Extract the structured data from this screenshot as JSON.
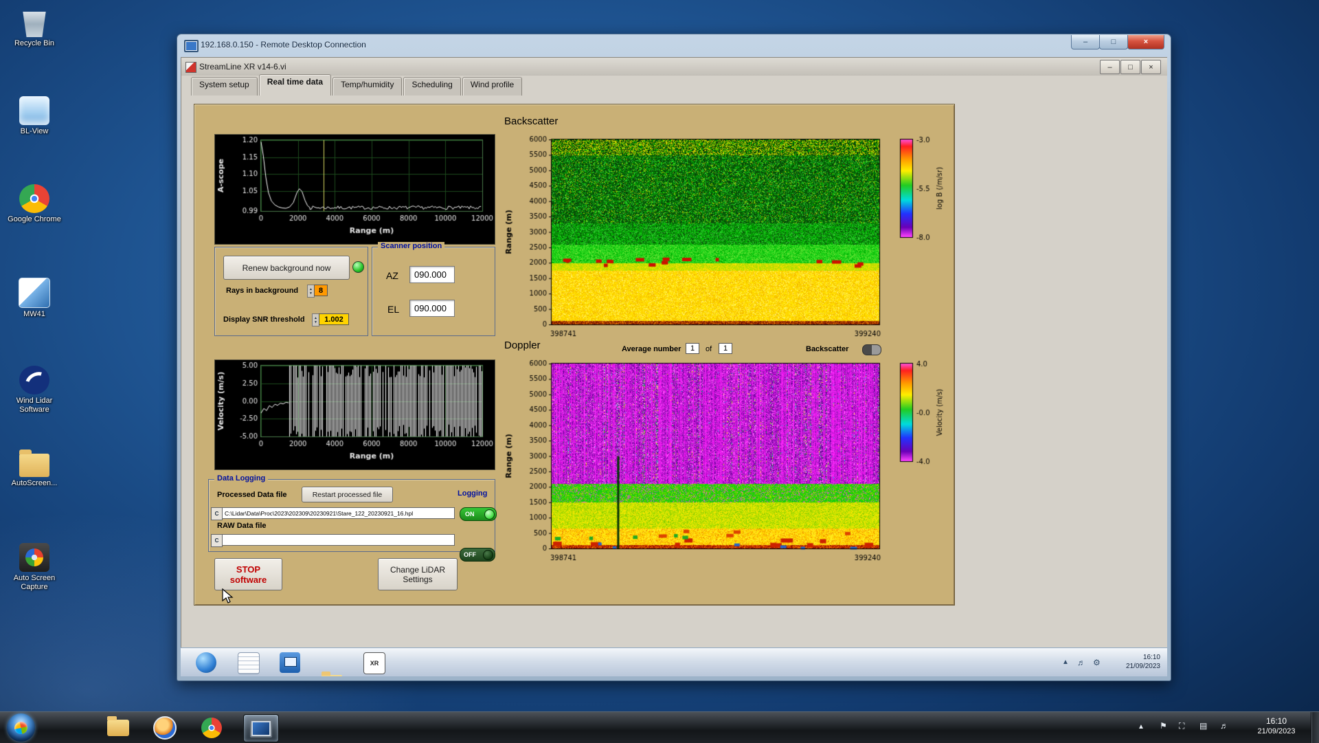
{
  "desktop": {
    "icons": [
      {
        "label": "Recycle Bin"
      },
      {
        "label": "BL-View"
      },
      {
        "label": "Google Chrome"
      },
      {
        "label": "MW41"
      },
      {
        "label": "Wind Lidar Software"
      },
      {
        "label": "AutoScreen..."
      },
      {
        "label": "Auto Screen Capture"
      }
    ]
  },
  "taskbar": {
    "clock_time": "16:10",
    "clock_date": "21/09/2023"
  },
  "rdp": {
    "title": "192.168.0.150 - Remote Desktop Connection"
  },
  "remote_taskbar": {
    "clock_time": "16:10",
    "clock_date": "21/09/2023"
  },
  "app": {
    "title": "StreamLine XR v14-6.vi",
    "tabs": [
      {
        "label": "System setup"
      },
      {
        "label": "Real time data"
      },
      {
        "label": "Temp/humidity"
      },
      {
        "label": "Scheduling"
      },
      {
        "label": "Wind profile"
      }
    ],
    "backscatter_section_label": "Backscatter",
    "doppler_section_label": "Doppler",
    "renew_button_label": "Renew background now",
    "rays_label": "Rays in background",
    "rays_value": "8",
    "snr_label": "Display SNR threshold",
    "snr_value": "1.002",
    "scanner": {
      "title": "Scanner position",
      "az_label": "AZ",
      "az_value": "090.000",
      "el_label": "EL",
      "el_value": "090.000"
    },
    "average": {
      "label": "Average number",
      "value": "1",
      "of_label": "of",
      "total": "1"
    },
    "backscatter_toggle_label": "Backscatter",
    "logging": {
      "title": "Data Logging",
      "processed_label": "Processed Data file",
      "restart_button_label": "Restart processed file",
      "processed_path": "C:\\Lidar\\Data\\Proc\\2023\\202309\\20230921\\Stare_122_20230921_16.hpl",
      "processed_state": "ON",
      "raw_label": "RAW Data file",
      "raw_path": "",
      "raw_state": "OFF",
      "logging_label": "Logging"
    },
    "stop_button_line1": "STOP",
    "stop_button_line2": "software",
    "settings_button_line1": "Change LiDAR",
    "settings_button_line2": "Settings"
  },
  "chart_data": [
    {
      "id": "ascope",
      "type": "line",
      "ylabel": "A-scope",
      "xlabel": "Range (m)",
      "xlim": [
        0,
        12000
      ],
      "ylim": [
        0.99,
        1.2
      ],
      "xticks": [
        0,
        2000,
        4000,
        6000,
        8000,
        10000,
        12000
      ],
      "yticks": [
        "1.20",
        "1.15",
        "1.10",
        "1.05",
        "0.99"
      ],
      "ytick_vals": [
        1.2,
        1.15,
        1.1,
        1.05,
        0.99
      ],
      "points": [
        [
          0,
          1.195
        ],
        [
          120,
          1.155
        ],
        [
          260,
          1.09
        ],
        [
          400,
          1.045
        ],
        [
          560,
          1.02
        ],
        [
          750,
          1.008
        ],
        [
          950,
          1.002
        ],
        [
          1150,
          0.999
        ],
        [
          1350,
          0.998
        ],
        [
          1550,
          1.002
        ],
        [
          1750,
          1.015
        ],
        [
          1950,
          1.045
        ],
        [
          2080,
          1.056
        ],
        [
          2220,
          1.048
        ],
        [
          2380,
          1.022
        ],
        [
          2520,
          1.006
        ],
        [
          2650,
          1.0
        ]
      ],
      "tail": {
        "from": 2650,
        "base": 1.0,
        "amp": 0.005
      },
      "cursor_x": 3400
    },
    {
      "id": "velocity",
      "type": "line",
      "ylabel": "Velocity (m/s)",
      "xlabel": "Range (m)",
      "xlim": [
        0,
        12000
      ],
      "ylim": [
        -5,
        5
      ],
      "xticks": [
        0,
        2000,
        4000,
        6000,
        8000,
        10000,
        12000
      ],
      "yticks": [
        "5.00",
        "2.50",
        "0.00",
        "-2.50",
        "-5.00"
      ],
      "ytick_vals": [
        5,
        2.5,
        0,
        -2.5,
        -5
      ],
      "points": [
        [
          0,
          -1.7
        ],
        [
          150,
          -1.05
        ],
        [
          300,
          -1.35
        ],
        [
          450,
          -0.65
        ],
        [
          600,
          -0.9
        ],
        [
          750,
          -0.45
        ],
        [
          900,
          -0.6
        ],
        [
          1050,
          -0.3
        ],
        [
          1200,
          -0.4
        ],
        [
          1350,
          -0.18
        ],
        [
          1500,
          -0.25
        ]
      ],
      "spikes": {
        "from": 1500,
        "prob": 0.82
      }
    },
    {
      "id": "backscatter",
      "type": "heatmap",
      "title": "Backscatter",
      "ylabel": "Range (m)",
      "ylim": [
        0,
        6000
      ],
      "yticks": [
        6000,
        5500,
        5000,
        4500,
        4000,
        3500,
        3000,
        2500,
        2000,
        1500,
        1000,
        500,
        0
      ],
      "x_start": "398741",
      "x_end": "399240",
      "colorbar": {
        "label": "log B (/m/sr)",
        "ticks": [
          "-3.0",
          "-5.5",
          "-8.0"
        ]
      },
      "bands": [
        {
          "to": 130,
          "colors": [
            "#7a1500",
            "#b84400",
            "#e07800"
          ],
          "weights": [
            0.45,
            0.35,
            0.2
          ]
        },
        {
          "to": 1750,
          "colors": [
            "#ffe400",
            "#ffd000",
            "#f0b400",
            "#fff066"
          ],
          "weights": [
            0.4,
            0.3,
            0.15,
            0.15
          ]
        },
        {
          "to": 2000,
          "colors": [
            "#ccdd00",
            "#aadd00",
            "#ffe000"
          ],
          "weights": [
            0.4,
            0.35,
            0.25
          ]
        },
        {
          "to": 2600,
          "colors": [
            "#11cc11",
            "#33dd22",
            "#66e033",
            "#00aa00"
          ],
          "weights": [
            0.35,
            0.3,
            0.2,
            0.15
          ]
        },
        {
          "to": 3300,
          "colors": [
            "#079907",
            "#00bb00",
            "#0a520a",
            "#33cc33"
          ],
          "weights": [
            0.3,
            0.25,
            0.25,
            0.2
          ]
        },
        {
          "to": 5500,
          "colors": [
            "#0a4d0a",
            "#076307",
            "#00aa00",
            "#33cc33",
            "#bbcc00",
            "#053305"
          ],
          "weights": [
            0.28,
            0.22,
            0.2,
            0.14,
            0.06,
            0.1
          ]
        },
        {
          "to": 6000,
          "colors": [
            "#0a4d0a",
            "#aabb00",
            "#00aa00",
            "#dddd00",
            "#053305"
          ],
          "weights": [
            0.25,
            0.22,
            0.2,
            0.16,
            0.17
          ]
        }
      ],
      "blobs": [
        {
          "alt": 2060,
          "count": 16,
          "color": "#cc1100",
          "wmin": 4,
          "wmax": 14,
          "h": 5
        }
      ]
    },
    {
      "id": "doppler",
      "type": "heatmap",
      "title": "Doppler",
      "ylabel": "Range (m)",
      "ylim": [
        0,
        6000
      ],
      "yticks": [
        6000,
        5500,
        5000,
        4500,
        4000,
        3500,
        3000,
        2500,
        2000,
        1500,
        1000,
        500,
        0
      ],
      "x_start": "398741",
      "x_end": "399240",
      "colorbar": {
        "label": "Velocity (m/s)",
        "ticks": [
          "4.0",
          "-0.0",
          "-4.0"
        ]
      },
      "bands": [
        {
          "to": 120,
          "colors": [
            "#991100",
            "#cc3300",
            "#ee7700"
          ],
          "weights": [
            0.4,
            0.35,
            0.25
          ]
        },
        {
          "to": 650,
          "colors": [
            "#ffd800",
            "#ffee22",
            "#ffb300",
            "#ee8800"
          ],
          "weights": [
            0.4,
            0.3,
            0.2,
            0.1
          ]
        },
        {
          "to": 1500,
          "colors": [
            "#d8e800",
            "#aadd00",
            "#ffe400",
            "#88cc00"
          ],
          "weights": [
            0.35,
            0.3,
            0.2,
            0.15
          ]
        },
        {
          "to": 2100,
          "colors": [
            "#11cc11",
            "#44cc00",
            "#99dd00",
            "#ee44ee"
          ],
          "weights": [
            0.45,
            0.28,
            0.17,
            0.1
          ]
        },
        {
          "to": 6000,
          "colors": [
            "#ff33ff",
            "#ee11ee",
            "#cc22dd",
            "#9911bb",
            "#660099",
            "#ff77ff",
            "#22bb44",
            "#eeee00",
            "#00bbee"
          ],
          "weights": [
            0.2,
            0.18,
            0.16,
            0.14,
            0.1,
            0.1,
            0.05,
            0.04,
            0.03
          ],
          "streaks": true
        }
      ],
      "blobs": [
        {
          "alt": 220,
          "count": 10,
          "color": "#cc2200",
          "wmin": 6,
          "wmax": 18,
          "h": 6
        },
        {
          "alt": 430,
          "count": 5,
          "color": "#22aa22",
          "wmin": 5,
          "wmax": 12,
          "h": 5
        },
        {
          "alt": 90,
          "count": 6,
          "color": "#2266cc",
          "wmin": 4,
          "wmax": 10,
          "h": 4
        },
        {
          "alt": 540,
          "count": 5,
          "color": "#dd4400",
          "wmin": 5,
          "wmax": 12,
          "h": 5
        }
      ],
      "dark_streak": {
        "xfrac": 0.2,
        "alt_to": 3000,
        "color": "#073307",
        "width": 3
      }
    }
  ]
}
